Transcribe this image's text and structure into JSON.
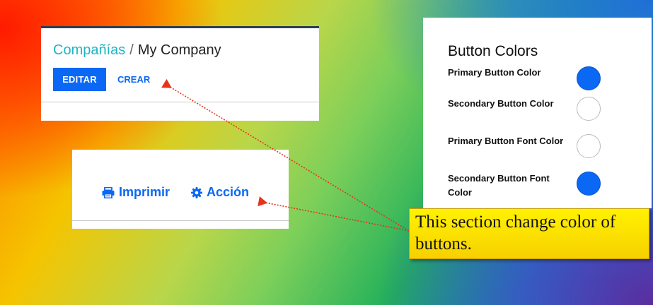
{
  "breadcrumb": {
    "parent": "Compañías",
    "separator": "/",
    "current": "My Company"
  },
  "form_buttons": {
    "edit_label": "EDITAR",
    "create_label": "CREAR"
  },
  "actions": {
    "print_label": "Imprimir",
    "action_label": "Acción"
  },
  "button_colors": {
    "title": "Button Colors",
    "rows": [
      {
        "label": "Primary Button Color",
        "color": "#0a68f5"
      },
      {
        "label": "Secondary Button Color",
        "color": "#ffffff"
      },
      {
        "label": "Primary Button Font Color",
        "color": "#ffffff"
      },
      {
        "label": "Secondary Button Font Color",
        "color": "#0a68f5"
      }
    ]
  },
  "note": {
    "text": "This section change color of buttons."
  },
  "colors": {
    "accent": "#0a68f5",
    "breadcrumb_link": "#1fb5c4",
    "note_bg": "#fff200",
    "arrow": "#e8331a"
  },
  "icons": {
    "print": "print-icon",
    "action": "gear-icon"
  }
}
